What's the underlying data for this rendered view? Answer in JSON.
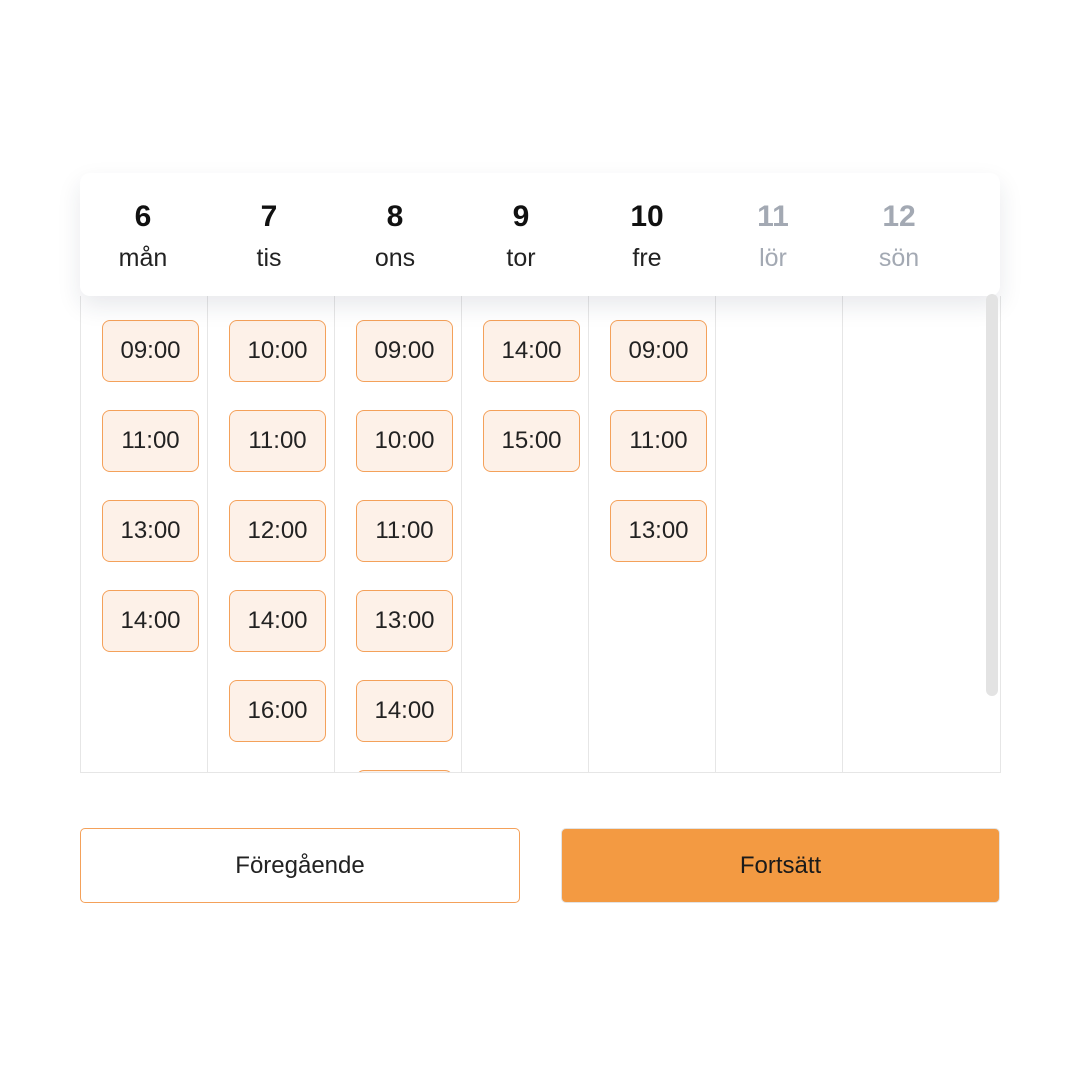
{
  "days": [
    {
      "num": "6",
      "name": "mån",
      "available": true,
      "slots": [
        "09:00",
        "11:00",
        "13:00",
        "14:00"
      ]
    },
    {
      "num": "7",
      "name": "tis",
      "available": true,
      "slots": [
        "10:00",
        "11:00",
        "12:00",
        "14:00",
        "16:00"
      ]
    },
    {
      "num": "8",
      "name": "ons",
      "available": true,
      "slots": [
        "09:00",
        "10:00",
        "11:00",
        "13:00",
        "14:00",
        ""
      ]
    },
    {
      "num": "9",
      "name": "tor",
      "available": true,
      "slots": [
        "14:00",
        "15:00"
      ]
    },
    {
      "num": "10",
      "name": "fre",
      "available": true,
      "slots": [
        "09:00",
        "11:00",
        "13:00"
      ]
    },
    {
      "num": "11",
      "name": "lör",
      "available": false,
      "slots": []
    },
    {
      "num": "12",
      "name": "sön",
      "available": false,
      "slots": []
    }
  ],
  "buttons": {
    "previous": "Föregående",
    "continue": "Fortsätt"
  },
  "colors": {
    "accent": "#f39a42",
    "slot_bg": "#fdf1e8",
    "slot_border": "#f4a15a",
    "disabled_text": "#a3a9b3"
  }
}
